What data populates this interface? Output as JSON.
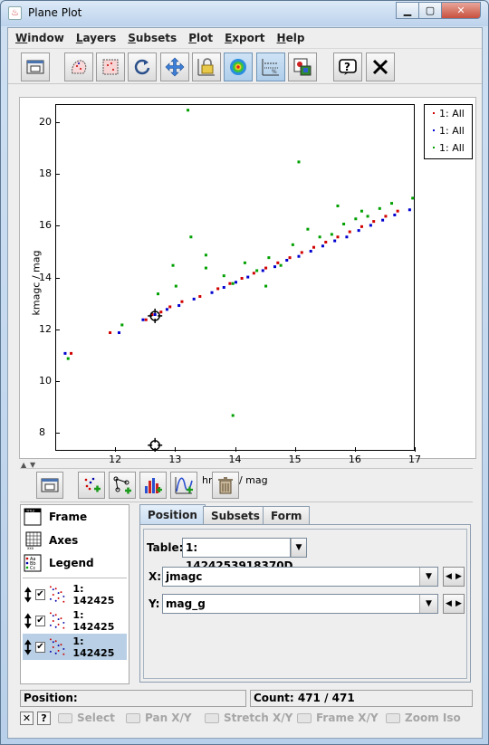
{
  "window": {
    "title": "Plane Plot",
    "minimize": "▁",
    "maximize": "▢",
    "close": "✕"
  },
  "menu": [
    "Window",
    "Layers",
    "Subsets",
    "Plot",
    "Export",
    "Help"
  ],
  "toolbar_icons": [
    "new-window-icon",
    "draw-subset-icon",
    "draw-polygon-icon",
    "reload-icon",
    "pan-arrows-icon",
    "lock-icon",
    "density-icon",
    "sketch-icon",
    "export-image-icon",
    "help-icon",
    "close-icon"
  ],
  "plot": {
    "xlabel": "hmagc / mag",
    "ylabel": "kmagc / mag",
    "xlim": [
      11,
      17
    ],
    "ylim": [
      7.3,
      20.7
    ],
    "xticks": [
      "12",
      "13",
      "14",
      "15",
      "16",
      "17"
    ],
    "yticks": [
      "8",
      "10",
      "12",
      "14",
      "16",
      "18",
      "20"
    ],
    "legend": [
      {
        "label": "1: All",
        "color": "#d00000"
      },
      {
        "label": "1: All",
        "color": "#0000d0"
      },
      {
        "label": "1: All",
        "color": "#00a000"
      }
    ],
    "colors": {
      "red": "#d00000",
      "blue": "#0000d0",
      "green": "#00a000"
    }
  },
  "chart_data": {
    "type": "scatter",
    "xlabel": "hmagc / mag",
    "ylabel": "kmagc / mag",
    "xlim": [
      11,
      17
    ],
    "ylim": [
      7.3,
      20.7
    ],
    "grid": false,
    "legend_position": "right",
    "total_count": "471 / 471",
    "series": [
      {
        "name": "1: All",
        "color": "#d00000",
        "x": [
          11.25,
          11.9,
          12.5,
          12.6,
          12.75,
          12.9,
          13.1,
          13.4,
          13.7,
          13.9,
          14.1,
          14.3,
          14.5,
          14.7,
          14.9,
          15.1,
          15.3,
          15.5,
          15.7,
          15.9,
          16.1,
          16.3,
          16.5,
          16.7
        ],
        "y": [
          11.1,
          11.9,
          12.4,
          12.6,
          12.7,
          12.9,
          13.1,
          13.3,
          13.6,
          13.8,
          14.0,
          14.2,
          14.4,
          14.6,
          14.8,
          15.0,
          15.2,
          15.4,
          15.6,
          15.8,
          16.0,
          16.2,
          16.4,
          16.6
        ]
      },
      {
        "name": "1: All",
        "color": "#0000d0",
        "x": [
          11.15,
          12.05,
          12.45,
          12.65,
          12.85,
          13.05,
          13.3,
          13.6,
          13.8,
          14.0,
          14.2,
          14.45,
          14.65,
          14.85,
          15.05,
          15.25,
          15.45,
          15.65,
          15.85,
          16.05,
          16.25,
          16.45,
          16.65,
          16.9
        ],
        "y": [
          11.1,
          11.9,
          12.4,
          12.6,
          12.8,
          12.95,
          13.2,
          13.45,
          13.65,
          13.85,
          14.05,
          14.3,
          14.45,
          14.7,
          14.85,
          15.05,
          15.25,
          15.45,
          15.6,
          15.85,
          16.05,
          16.25,
          16.45,
          16.65
        ]
      },
      {
        "name": "1: All",
        "color": "#00a000",
        "x": [
          11.2,
          12.1,
          12.7,
          13.0,
          13.2,
          13.25,
          13.5,
          13.8,
          13.95,
          14.15,
          14.35,
          14.55,
          14.75,
          14.95,
          15.05,
          15.2,
          15.4,
          15.6,
          15.8,
          16.0,
          16.2,
          16.4,
          16.6,
          16.95,
          12.95,
          13.5,
          13.95,
          15.7,
          16.1,
          14.5
        ],
        "y": [
          10.9,
          12.2,
          13.4,
          13.7,
          20.5,
          15.6,
          14.4,
          14.1,
          8.7,
          14.6,
          14.3,
          14.8,
          14.5,
          15.3,
          18.5,
          15.9,
          15.6,
          15.7,
          16.1,
          16.3,
          16.4,
          16.7,
          16.9,
          17.1,
          14.5,
          14.9,
          13.8,
          16.8,
          16.6,
          13.7
        ]
      }
    ]
  },
  "cursors": [
    {
      "x": 12.65,
      "y": 12.55
    },
    {
      "x": 12.65,
      "y": 7.55
    }
  ],
  "layers": {
    "static": [
      {
        "label": "Frame",
        "icon": "frame-icon"
      },
      {
        "label": "Axes",
        "icon": "axes-icon"
      },
      {
        "label": "Legend",
        "icon": "legend-icon"
      }
    ],
    "items": [
      {
        "label": "1: 142425",
        "checked": "✔"
      },
      {
        "label": "1: 142425",
        "checked": "✔"
      },
      {
        "label": "1: 142425",
        "checked": "✔"
      }
    ]
  },
  "tabs": [
    "Position",
    "Subsets",
    "Form"
  ],
  "position": {
    "table_label": "Table:",
    "table_value": "1: 1424253918370D",
    "x_label": "X:",
    "x_value": "jmagc",
    "y_label": "Y:",
    "y_value": "mag_g"
  },
  "status": {
    "position_label": "Position:",
    "count_label": "Count: 471 / 471"
  },
  "bottom_bar": {
    "close_mini": "✕",
    "help_mini": "?",
    "hints": [
      "Select",
      "Pan X/Y",
      "Stretch X/Y",
      "Frame X/Y",
      "Zoom Iso"
    ]
  }
}
